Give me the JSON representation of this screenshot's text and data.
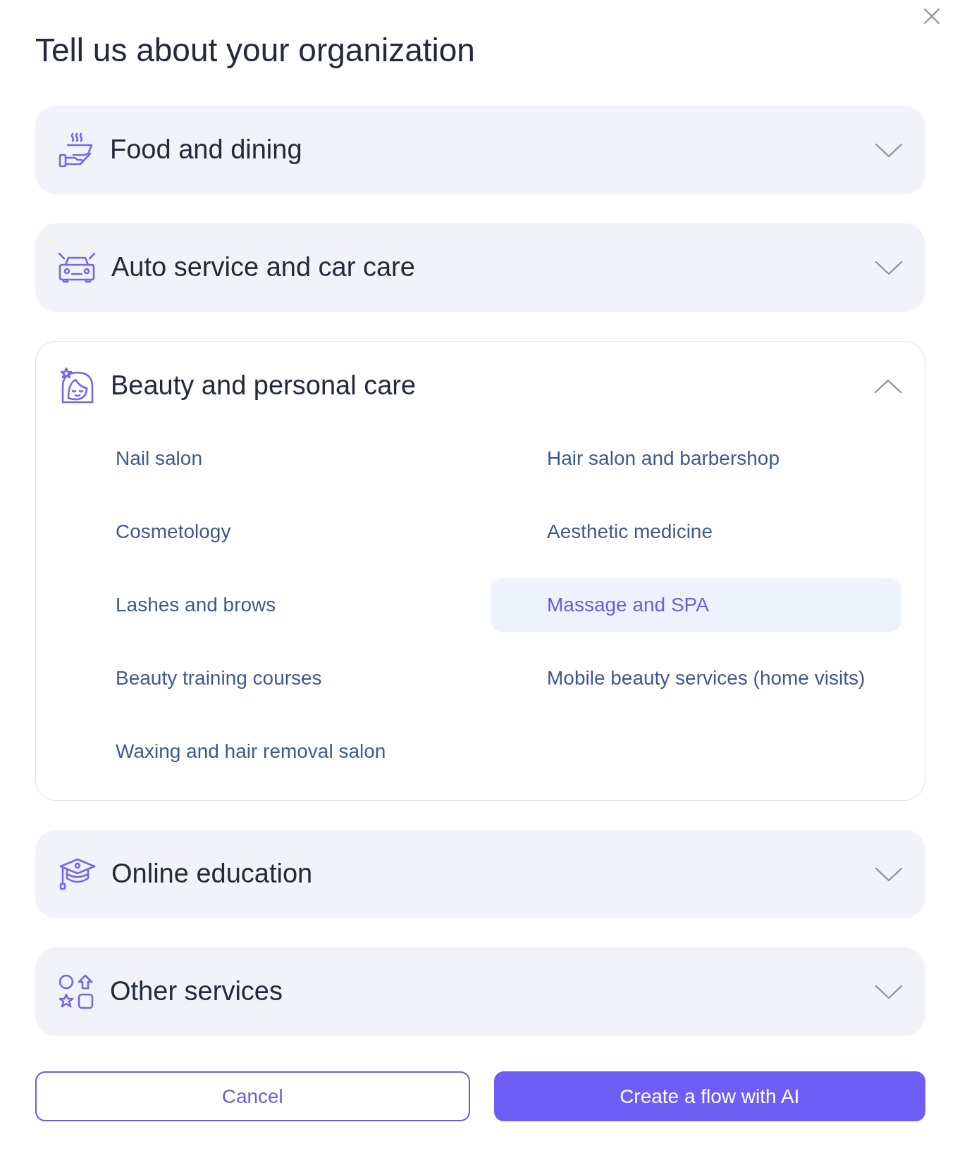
{
  "dialog": {
    "title": "Tell us about your organization"
  },
  "categories": [
    {
      "label": "Food and dining",
      "expanded": false
    },
    {
      "label": "Auto service and car care",
      "expanded": false
    },
    {
      "label": "Beauty and personal care",
      "expanded": true,
      "items": [
        {
          "label": "Nail salon",
          "selected": false
        },
        {
          "label": "Hair salon and barbershop",
          "selected": false
        },
        {
          "label": "Cosmetology",
          "selected": false
        },
        {
          "label": "Aesthetic medicine",
          "selected": false
        },
        {
          "label": "Lashes and brows",
          "selected": false
        },
        {
          "label": "Massage and SPA",
          "selected": true
        },
        {
          "label": "Beauty training courses",
          "selected": false
        },
        {
          "label": "Mobile beauty services (home visits)",
          "selected": false
        },
        {
          "label": "Waxing and hair removal salon",
          "selected": false
        }
      ]
    },
    {
      "label": "Online education",
      "expanded": false
    },
    {
      "label": "Other services",
      "expanded": false
    }
  ],
  "buttons": [
    {
      "label": "Cancel",
      "kind": "secondary"
    },
    {
      "label": "Create a flow with AI",
      "kind": "primary"
    }
  ]
}
